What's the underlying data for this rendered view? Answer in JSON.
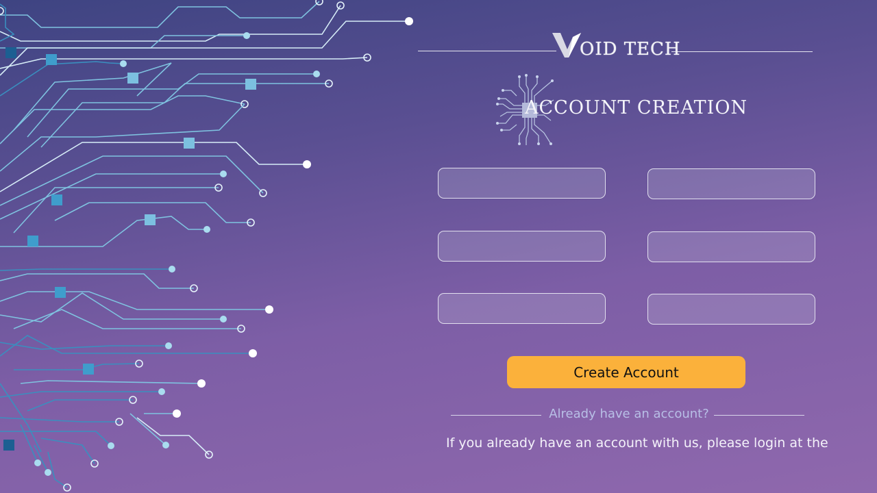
{
  "brand": {
    "name": "OID TECH",
    "logo_icon": "v-logo-icon"
  },
  "section": {
    "title": "ACCOUNT CREATION",
    "icon": "circuit-chip-icon"
  },
  "form": {
    "fields": [
      {
        "value": "",
        "placeholder": ""
      },
      {
        "value": "",
        "placeholder": ""
      },
      {
        "value": "",
        "placeholder": ""
      },
      {
        "value": "",
        "placeholder": ""
      },
      {
        "value": "",
        "placeholder": ""
      },
      {
        "value": "",
        "placeholder": ""
      }
    ],
    "submit_label": "Create Account"
  },
  "login": {
    "prompt": "Already have an account?",
    "note": "If you already have an account with us, please login at the"
  },
  "colors": {
    "background_top": "#3e4482",
    "background_bottom": "#8f68ad",
    "button": "#fbb13b",
    "circuit_dark": "#1f6a9a",
    "circuit_light": "#dff2fb"
  }
}
